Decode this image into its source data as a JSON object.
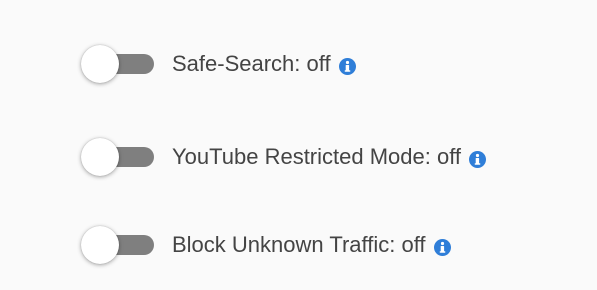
{
  "settings": [
    {
      "label": "Safe-Search: off",
      "state": "off",
      "icon": "info-icon"
    },
    {
      "label": "YouTube Restricted Mode: off",
      "state": "off",
      "icon": "info-icon"
    },
    {
      "label": "Block Unknown Traffic: off",
      "state": "off",
      "icon": "info-icon"
    }
  ],
  "colors": {
    "background": "#fafafa",
    "text": "#444444",
    "toggle_track_off": "#7f7f7f",
    "toggle_thumb": "#ffffff",
    "info_icon": "#2f7ed8"
  }
}
